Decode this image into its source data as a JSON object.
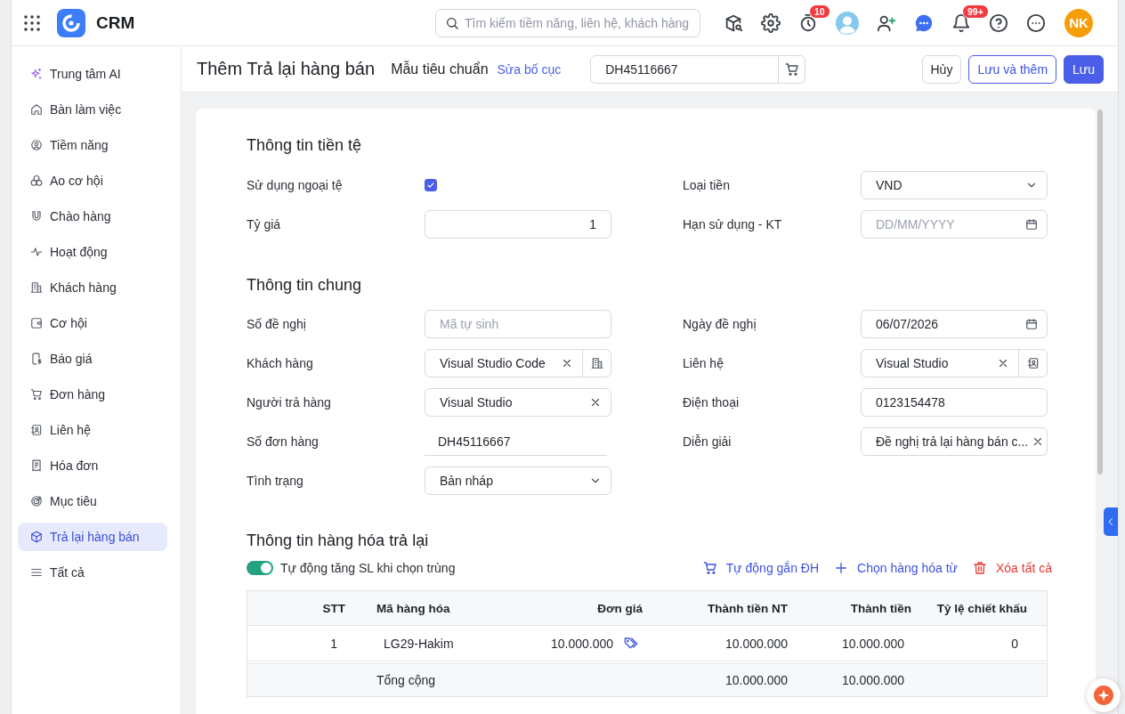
{
  "topbar": {
    "app_name": "CRM",
    "search": {
      "placeholder": "Tìm kiếm tiềm năng, liên hệ, khách hàng"
    },
    "timer_badge": "10",
    "notification_badge": "99+",
    "avatar_initials": "NK"
  },
  "sidebar": {
    "items": [
      {
        "label": "Trung tâm AI",
        "selected": false
      },
      {
        "label": "Bàn làm việc",
        "selected": false
      },
      {
        "label": "Tiềm năng",
        "selected": false
      },
      {
        "label": "Ao cơ hội",
        "selected": false
      },
      {
        "label": "Chào hàng",
        "selected": false
      },
      {
        "label": "Hoạt động",
        "selected": false
      },
      {
        "label": "Khách hàng",
        "selected": false
      },
      {
        "label": "Cơ hội",
        "selected": false
      },
      {
        "label": "Báo giá",
        "selected": false
      },
      {
        "label": "Đơn hàng",
        "selected": false
      },
      {
        "label": "Liên hệ",
        "selected": false
      },
      {
        "label": "Hóa đơn",
        "selected": false
      },
      {
        "label": "Mục tiêu",
        "selected": false
      },
      {
        "label": "Trả lại hàng bán",
        "selected": true
      },
      {
        "label": "Tất cả",
        "selected": false
      }
    ]
  },
  "header": {
    "title": "Thêm Trả lại hàng bán",
    "template": "Mẫu tiêu chuẩn",
    "edit_layout": "Sửa bố cục",
    "order_field": {
      "value": "DH45116667"
    },
    "buttons": [
      {
        "label": "Hủy",
        "kind": "secondary"
      },
      {
        "label": "Lưu và thêm",
        "kind": "outline"
      },
      {
        "label": "Lưu",
        "kind": "primary"
      }
    ]
  },
  "sections": [
    {
      "title": "Thông tin tiền tệ",
      "fields": [
        {
          "label": "Sử dụng ngoại tệ",
          "kind": "checkbox",
          "checked": true
        },
        {
          "label": "Loại tiền",
          "kind": "select",
          "value": "VND"
        },
        {
          "label": "Tỷ giá",
          "kind": "number",
          "value": "1"
        },
        {
          "label": "Hạn sử dụng - KT",
          "kind": "date",
          "placeholder": "DD/MM/YYYY"
        }
      ]
    },
    {
      "title": "Thông tin chung",
      "fields": [
        {
          "label": "Số đề nghị",
          "kind": "text",
          "placeholder": "Mã tự sinh"
        },
        {
          "label": "Ngày đề nghị",
          "kind": "date",
          "value": "06/07/2026"
        },
        {
          "label": "Khách hàng",
          "kind": "lookup",
          "value": "Visual Studio Code"
        },
        {
          "label": "Liên hệ",
          "kind": "lookup",
          "value": "Visual Studio"
        },
        {
          "label": "Người trả hàng",
          "kind": "clearable",
          "value": "Visual Studio"
        },
        {
          "label": "Điện thoại",
          "kind": "text",
          "value": "0123154478"
        },
        {
          "label": "Số đơn hàng",
          "kind": "readonly",
          "value": "DH45116667"
        },
        {
          "label": "Diễn giải",
          "kind": "clearable",
          "value": "Đề nghị trả lại hàng bán c..."
        },
        {
          "label": "Tình trạng",
          "kind": "select",
          "value": "Bản nháp"
        }
      ]
    }
  ],
  "goods": {
    "title": "Thông tin hàng hóa trả lại",
    "toggle": {
      "label": "Tự động tăng SL khi chọn trùng",
      "on": true
    },
    "actions": [
      {
        "label": "Tự động gắn ĐH",
        "kind": "link"
      },
      {
        "label": "Chọn hàng hóa từ",
        "kind": "link"
      },
      {
        "label": "Xóa tất cả",
        "kind": "danger"
      }
    ],
    "table": {
      "columns": [
        "STT",
        "Mã hàng hóa",
        "Đơn giá",
        "Thành tiền NT",
        "Thành tiền",
        "Tỷ lệ chiết khấu"
      ],
      "rows": [
        {
          "cells": [
            "1",
            "LG29-Hakim",
            "10.000.000",
            "10.000.000",
            "10.000.000",
            "0"
          ]
        }
      ],
      "total": {
        "label": "Tổng cộng",
        "amount_nt": "10.000.000",
        "amount": "10.000.000"
      }
    }
  }
}
